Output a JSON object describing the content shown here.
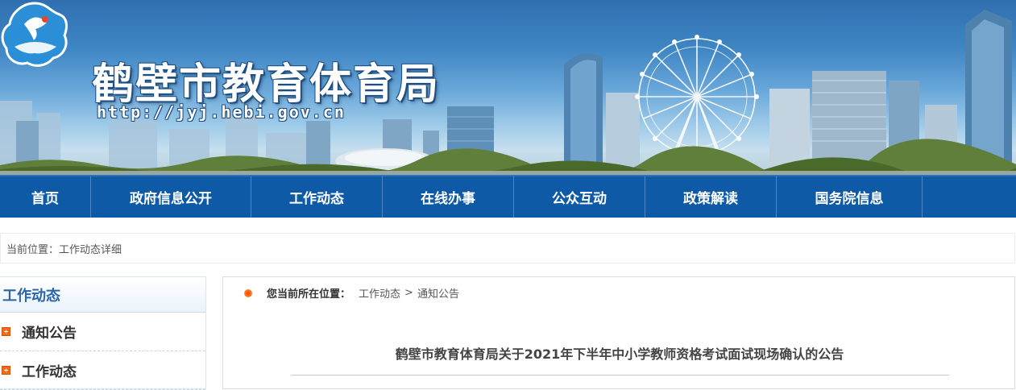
{
  "site": {
    "name": "鹤壁市教育体育局",
    "url": "http://jyj.hebi.gov.cn"
  },
  "nav": {
    "items": [
      {
        "label": "首页"
      },
      {
        "label": "政府信息公开"
      },
      {
        "label": "工作动态"
      },
      {
        "label": "在线办事"
      },
      {
        "label": "公众互动"
      },
      {
        "label": "政策解读"
      },
      {
        "label": "国务院信息"
      }
    ]
  },
  "location_bar": {
    "text": "当前位置：工作动态详细"
  },
  "sidebar": {
    "title": "工作动态",
    "items": [
      {
        "label": "通知公告",
        "icon": "plus-square-icon"
      },
      {
        "label": "工作动态",
        "icon": "plus-square-icon"
      }
    ]
  },
  "content": {
    "breadcrumb": {
      "label": "您当前所在位置：",
      "items": [
        "工作动态",
        "通知公告"
      ],
      "separator": ">"
    },
    "article_title": "鹤壁市教育体育局关于2021年下半年中小学教师资格考试面试现场确认的公告"
  },
  "colors": {
    "nav_bg": "#0e5aa6",
    "accent_blue": "#2b64a8",
    "icon_orange": "#f26b1d"
  }
}
